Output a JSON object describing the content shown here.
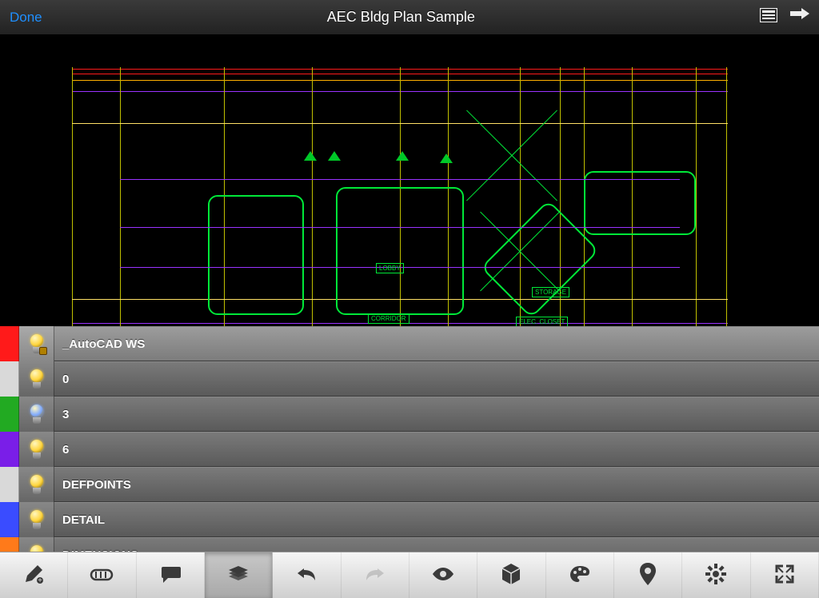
{
  "header": {
    "done_label": "Done",
    "title": "AEC Bldg Plan Sample"
  },
  "layers": [
    {
      "name": "_AutoCAD WS",
      "color": "#ff1a1a",
      "selected": true,
      "bulb": "on",
      "locked": true
    },
    {
      "name": "0",
      "color": "#d9d9d9",
      "selected": false,
      "bulb": "on",
      "locked": false
    },
    {
      "name": "3",
      "color": "#22aa22",
      "selected": false,
      "bulb": "off",
      "locked": false
    },
    {
      "name": "6",
      "color": "#7a1ee8",
      "selected": false,
      "bulb": "on",
      "locked": false
    },
    {
      "name": "DEFPOINTS",
      "color": "#d9d9d9",
      "selected": false,
      "bulb": "on",
      "locked": false
    },
    {
      "name": "DETAIL",
      "color": "#3a4cff",
      "selected": false,
      "bulb": "on",
      "locked": false
    },
    {
      "name": "DIMENSIONS",
      "color": "#ff7a1a",
      "selected": false,
      "bulb": "on",
      "locked": false
    }
  ],
  "canvas_labels": {
    "lobby": "LOBBY",
    "corridor": "CORRIDOR",
    "storage": "STORAGE",
    "elec": "ELEC. CLOSET"
  },
  "drawing_colors": {
    "walls": "#9a32ff",
    "structure": "#ffe066",
    "rounded_zones": "#00e838",
    "dim_top": "#ff1a1a",
    "guides": "#e0d070",
    "section_marks": "#00e838"
  },
  "toolbar": {
    "tools": [
      {
        "id": "draw",
        "active": false
      },
      {
        "id": "measure",
        "active": false
      },
      {
        "id": "comment",
        "active": false
      },
      {
        "id": "layers",
        "active": true
      },
      {
        "id": "undo",
        "active": false
      },
      {
        "id": "redo",
        "active": false,
        "disabled": true
      },
      {
        "id": "view",
        "active": false
      },
      {
        "id": "grid",
        "active": false
      },
      {
        "id": "palette",
        "active": false
      },
      {
        "id": "location",
        "active": false
      },
      {
        "id": "settings",
        "active": false
      },
      {
        "id": "expand",
        "active": false
      }
    ]
  }
}
